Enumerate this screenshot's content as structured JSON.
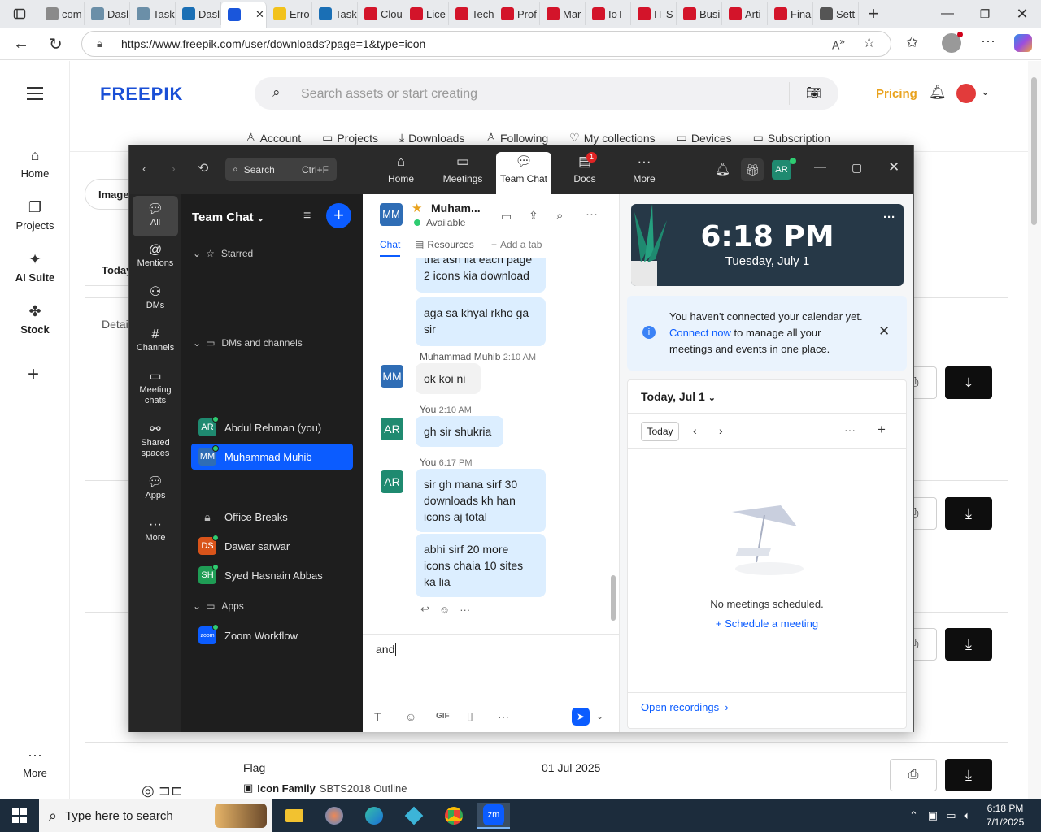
{
  "browser": {
    "tabs": [
      {
        "label": "com",
        "color": "#8a8a8a"
      },
      {
        "label": "Dasl",
        "color": "#6b8fa8"
      },
      {
        "label": "Task",
        "color": "#6b8fa8"
      },
      {
        "label": "Dasl",
        "color": "#1a6fb5"
      },
      {
        "label": "",
        "color": "#1a56db"
      },
      {
        "label": "Erro",
        "color": "#f2c21b"
      },
      {
        "label": "Task",
        "color": "#1a6fb5"
      },
      {
        "label": "Clou",
        "color": "#d3142a"
      },
      {
        "label": "Lice",
        "color": "#d3142a"
      },
      {
        "label": "Tech",
        "color": "#d3142a"
      },
      {
        "label": "Prof",
        "color": "#d3142a"
      },
      {
        "label": "Mar",
        "color": "#d3142a"
      },
      {
        "label": "IoT",
        "color": "#d3142a"
      },
      {
        "label": "IT S",
        "color": "#d3142a"
      },
      {
        "label": "Busi",
        "color": "#d3142a"
      },
      {
        "label": "Arti",
        "color": "#d3142a"
      },
      {
        "label": "Fina",
        "color": "#d3142a"
      },
      {
        "label": "Sett",
        "color": "#555555"
      }
    ],
    "url": "https://www.freepik.com/user/downloads?page=1&type=icon"
  },
  "freepik": {
    "logo": "FREEPIK",
    "search_placeholder": "Search assets or start creating",
    "pricing": "Pricing",
    "nav": [
      "Account",
      "Projects",
      "Downloads",
      "Following",
      "My collections",
      "Devices",
      "Subscription"
    ],
    "side": [
      "Home",
      "Projects",
      "AI Suite",
      "Stock",
      "More"
    ],
    "images_label": "Images",
    "today_label": "Today",
    "details_label": "Detai",
    "row": {
      "name": "Flag",
      "date": "01 Jul 2025",
      "type": "Icon Family",
      "family": "SBTS2018 Outline"
    }
  },
  "zoom": {
    "search_label": "Search",
    "search_shortcut": "Ctrl+F",
    "top_tabs": [
      "Home",
      "Meetings",
      "Team Chat",
      "Docs",
      "More"
    ],
    "docs_badge": "1",
    "self_initials": "AR",
    "rail": [
      "All",
      "Mentions",
      "DMs",
      "Channels",
      "Meeting chats",
      "Shared spaces",
      "Apps",
      "More"
    ],
    "list_title": "Team Chat",
    "sections": {
      "starred": "Starred",
      "dms": "DMs and channels",
      "apps": "Apps"
    },
    "contacts": [
      {
        "initials": "AR",
        "name": "Abdul Rehman (you)",
        "color": "#1f8a70"
      },
      {
        "initials": "MM",
        "name": "Muhammad Muhib",
        "color": "#2f6db5"
      },
      {
        "initials": "DS",
        "name": "Dawar sarwar",
        "color": "#d9541a"
      },
      {
        "initials": "SH",
        "name": "Syed Hasnain Abbas",
        "color": "#1f9d55"
      }
    ],
    "channel": "Office Breaks",
    "app": {
      "initials": "zoom",
      "name": "Zoom Workflow"
    },
    "chat": {
      "contact_initials": "MM",
      "contact_name": "Muham...",
      "status": "Available",
      "tabs": [
        "Chat",
        "Resources",
        "Add a tab"
      ],
      "messages": [
        {
          "text": "tha ash lia each page 2 icons kia download"
        },
        {
          "text": "aga sa khyal rkho ga sir"
        },
        {
          "sender": "Muhammad Muhib",
          "time": "2:10 AM",
          "initials": "MM",
          "text": "ok koi ni"
        },
        {
          "sender": "You",
          "time": "2:10 AM",
          "initials": "AR",
          "text": "gh sir shukria"
        },
        {
          "sender": "You",
          "time": "6:17 PM",
          "initials": "AR",
          "text": "sir gh mana sirf 30 downloads kh han icons  aj total"
        },
        {
          "text": "abhi sirf 20 more icons chaia 10 sites ka lia"
        }
      ],
      "compose_value": "and "
    },
    "panel": {
      "time": "6:18 PM",
      "date": "Tuesday, July 1",
      "notice_pre": "You haven't connected your calendar yet.",
      "notice_link": "Connect now",
      "notice_post": "to manage all your meetings and events in one place.",
      "today_header": "Today, Jul 1",
      "today_button": "Today",
      "empty": "No meetings scheduled.",
      "schedule": "Schedule a meeting",
      "open_recordings": "Open recordings"
    }
  },
  "taskbar": {
    "search_placeholder": "Type here to search",
    "time": "6:18 PM",
    "date": "7/1/2025"
  }
}
